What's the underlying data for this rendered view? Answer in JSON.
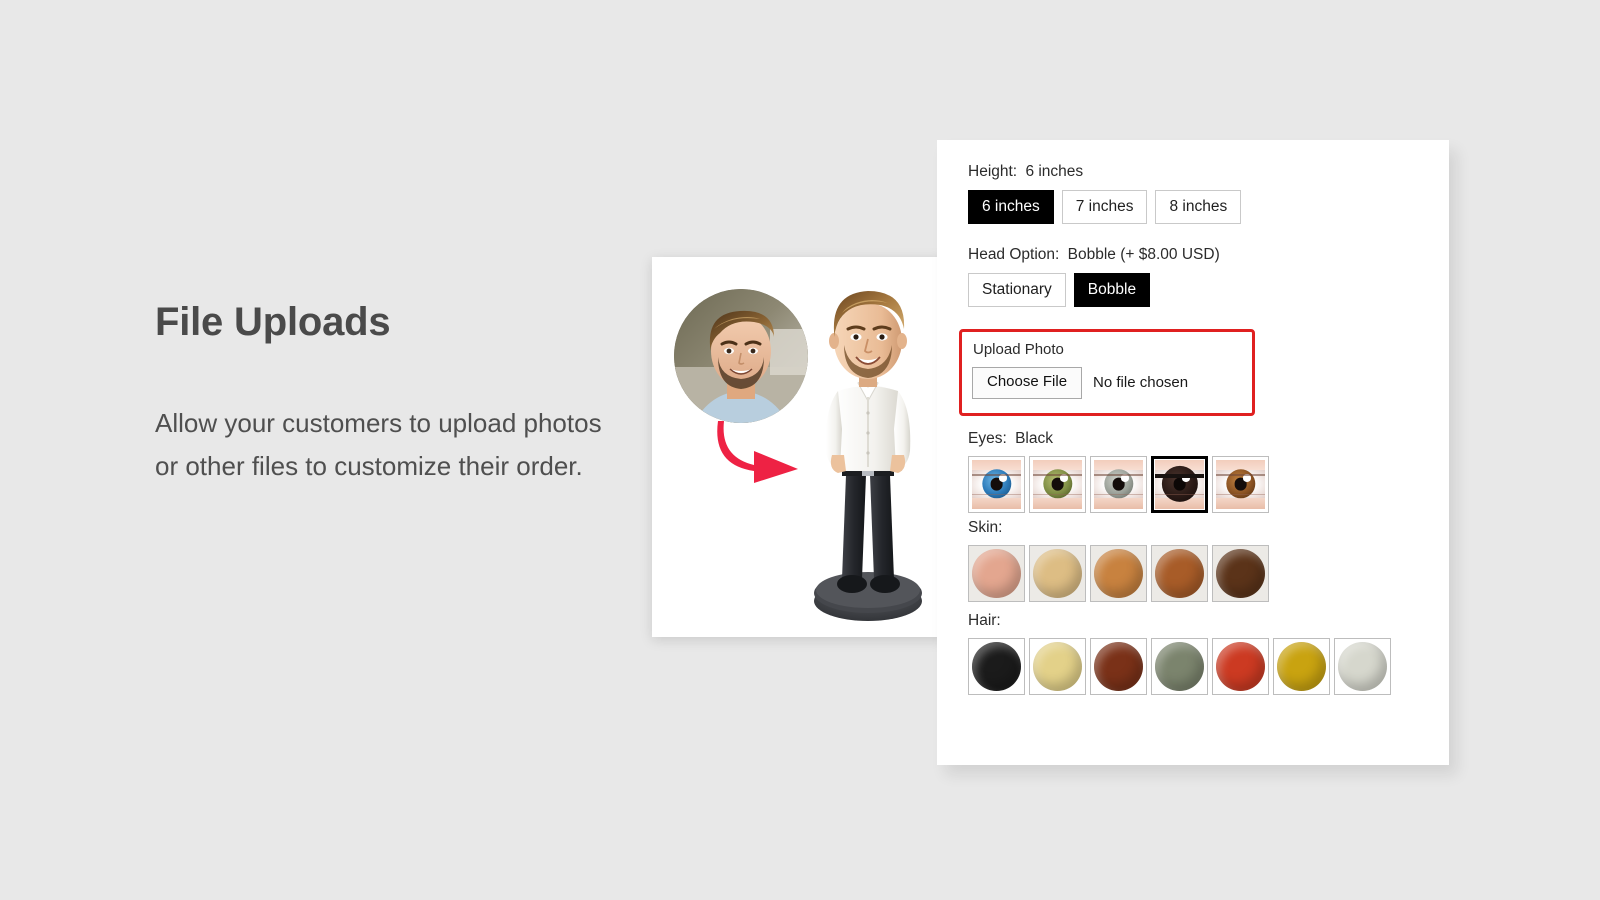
{
  "background_color": "#e8e8e8",
  "marketing": {
    "headline": "File Uploads",
    "body": "Allow your customers to upload photos or other files to customize their order."
  },
  "product_card": {
    "name": "bobblehead-preview",
    "face_photo_alt": "customer-face-photo",
    "arrow_color": "#ee2244",
    "bobblehead_alt": "custom-bobblehead-figurine"
  },
  "options": {
    "height": {
      "label": "Height:",
      "value": "6 inches",
      "choices": [
        {
          "label": "6 inches",
          "selected": true
        },
        {
          "label": "7 inches",
          "selected": false
        },
        {
          "label": "8 inches",
          "selected": false
        }
      ]
    },
    "head_option": {
      "label": "Head Option:",
      "value": "Bobble  (+ $8.00 USD)",
      "choices": [
        {
          "label": "Stationary",
          "selected": false
        },
        {
          "label": "Bobble",
          "selected": true
        }
      ]
    },
    "upload": {
      "title": "Upload Photo",
      "button_label": "Choose File",
      "status": "No file chosen",
      "highlight_color": "#e02020"
    },
    "eyes": {
      "label": "Eyes:",
      "value": "Black",
      "swatches": [
        {
          "name": "Blue",
          "iris": "#2b79b8",
          "selected": false
        },
        {
          "name": "Green",
          "iris": "#7d8c43",
          "selected": false
        },
        {
          "name": "Gray",
          "iris": "#9aa098",
          "selected": false
        },
        {
          "name": "Black",
          "iris": "#2a1a16",
          "selected": true
        },
        {
          "name": "Brown",
          "iris": "#8a5222",
          "selected": false
        }
      ]
    },
    "skin": {
      "label": "Skin:",
      "value": "",
      "swatches": [
        {
          "name": "Light",
          "color": "#e3a68f",
          "selected": false
        },
        {
          "name": "Fair",
          "color": "#ddbd84",
          "selected": false
        },
        {
          "name": "Medium",
          "color": "#c8823f",
          "selected": false
        },
        {
          "name": "Tan",
          "color": "#a85c28",
          "selected": false
        },
        {
          "name": "Dark",
          "color": "#5b3319",
          "selected": false
        }
      ]
    },
    "hair": {
      "label": "Hair:",
      "value": "",
      "swatches": [
        {
          "name": "Black",
          "color": "#1b1b1b",
          "selected": false
        },
        {
          "name": "Blonde",
          "color": "#e3d189",
          "selected": false
        },
        {
          "name": "Auburn",
          "color": "#7a3118",
          "selected": false
        },
        {
          "name": "Gray-Green",
          "color": "#7b846d",
          "selected": false
        },
        {
          "name": "Red",
          "color": "#cc3a22",
          "selected": false
        },
        {
          "name": "Gold",
          "color": "#c9a310",
          "selected": false
        },
        {
          "name": "White",
          "color": "#d6d7cd",
          "selected": false
        }
      ]
    }
  }
}
